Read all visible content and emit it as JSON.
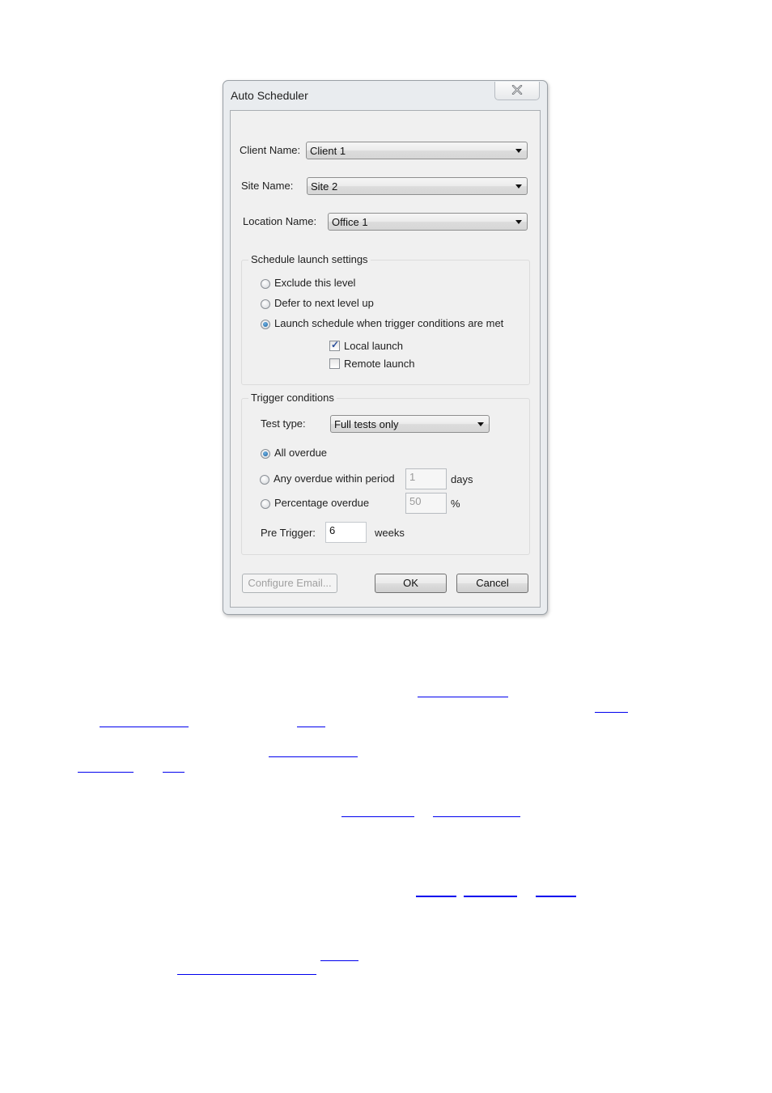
{
  "window": {
    "title": "Auto Scheduler",
    "close_icon": "close-x-icon"
  },
  "fields": {
    "client_name": {
      "label": "Client Name:",
      "value": "Client 1"
    },
    "site_name": {
      "label": "Site Name:",
      "value": "Site 2"
    },
    "location_name": {
      "label": "Location Name:",
      "value": "Office 1"
    }
  },
  "schedule_launch": {
    "title": "Schedule launch settings",
    "options": [
      {
        "label": "Exclude this level",
        "selected": false
      },
      {
        "label": "Defer to next level up",
        "selected": false
      },
      {
        "label": "Launch schedule when trigger conditions are met",
        "selected": true
      }
    ],
    "checkboxes": [
      {
        "label": "Local launch",
        "checked": true
      },
      {
        "label": "Remote launch",
        "checked": false
      }
    ]
  },
  "trigger": {
    "title": "Trigger conditions",
    "test_type_label": "Test type:",
    "test_type_value": "Full tests only",
    "options": [
      {
        "label": "All overdue",
        "selected": true
      },
      {
        "label": "Any overdue within period",
        "selected": false,
        "value": "1",
        "unit": "days"
      },
      {
        "label": "Percentage overdue",
        "selected": false,
        "value": "50",
        "unit": "%"
      }
    ],
    "pre_trigger_label": "Pre Trigger:",
    "pre_trigger_value": "6",
    "pre_trigger_unit": "weeks"
  },
  "buttons": {
    "configure_email": "Configure Email...",
    "ok": "OK",
    "cancel": "Cancel"
  },
  "colors": {
    "link": "#0000ee"
  }
}
